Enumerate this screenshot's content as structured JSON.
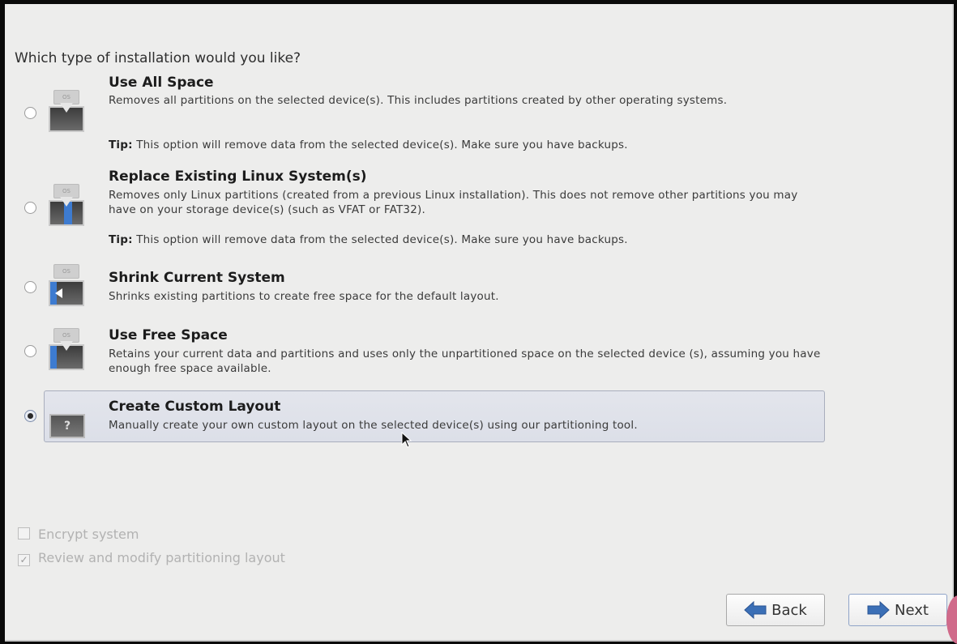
{
  "question": "Which type of installation would you like?",
  "options": [
    {
      "title": "Use All Space",
      "desc": "Removes all partitions on the selected device(s).  This includes partitions created by other operating systems.",
      "tip_label": "Tip:",
      "tip": " This option will remove data from the selected device(s).  Make sure you have backups.",
      "icon": "os-disk-wipe-icon",
      "os_label": "OS",
      "selected": false
    },
    {
      "title": "Replace Existing Linux System(s)",
      "desc": "Removes only Linux partitions (created from a previous Linux installation).  This does not remove other partitions you may have on your storage device(s) (such as VFAT or FAT32).",
      "tip_label": "Tip:",
      "tip": " This option will remove data from the selected device(s).  Make sure you have backups.",
      "icon": "os-disk-replace-icon",
      "os_label": "OS",
      "selected": false
    },
    {
      "title": "Shrink Current System",
      "desc": "Shrinks existing partitions to create free space for the default layout.",
      "icon": "os-disk-shrink-icon",
      "os_label": "OS",
      "selected": false
    },
    {
      "title": "Use Free Space",
      "desc": "Retains your current data and partitions and uses only the unpartitioned space on the selected device (s), assuming you have enough free space available.",
      "icon": "os-disk-free-icon",
      "os_label": "OS",
      "selected": false
    },
    {
      "title": "Create Custom Layout",
      "desc": "Manually create your own custom layout on the selected device(s) using our partitioning tool.",
      "icon": "custom-disk-question-icon",
      "icon_text": "?",
      "selected": true
    }
  ],
  "checkboxes": [
    {
      "label": "Encrypt system",
      "checked": false,
      "enabled": false,
      "mark": ""
    },
    {
      "label": "Review and modify partitioning layout",
      "checked": true,
      "enabled": false,
      "mark": "✓"
    }
  ],
  "buttons": {
    "back": "Back",
    "next": "Next"
  },
  "colors": {
    "arrow_blue": "#3b6fb6",
    "selection_bg": "#dfe2ea",
    "background": "#ededec"
  }
}
